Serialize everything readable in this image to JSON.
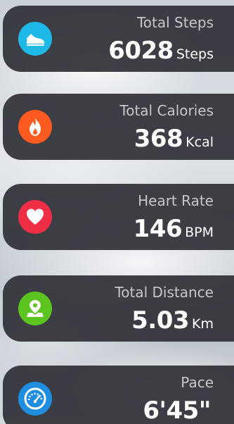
{
  "metrics": [
    {
      "label": "Total Steps",
      "value": "6028",
      "unit": "Steps",
      "icon": "shoe-icon",
      "icon_color": "#1fb9e8"
    },
    {
      "label": "Total Calories",
      "value": "368",
      "unit": "Kcal",
      "icon": "flame-icon",
      "icon_color": "#ff5a1f"
    },
    {
      "label": "Heart Rate",
      "value": "146",
      "unit": "BPM",
      "icon": "heart-icon",
      "icon_color": "#ee2e45"
    },
    {
      "label": "Total Distance",
      "value": "5.03",
      "unit": "Km",
      "icon": "map-pin-icon",
      "icon_color": "#5bc41f"
    },
    {
      "label": "Pace",
      "value": "6'45\"",
      "unit": "",
      "icon": "speedometer-icon",
      "icon_color": "#1e8fe0"
    }
  ]
}
